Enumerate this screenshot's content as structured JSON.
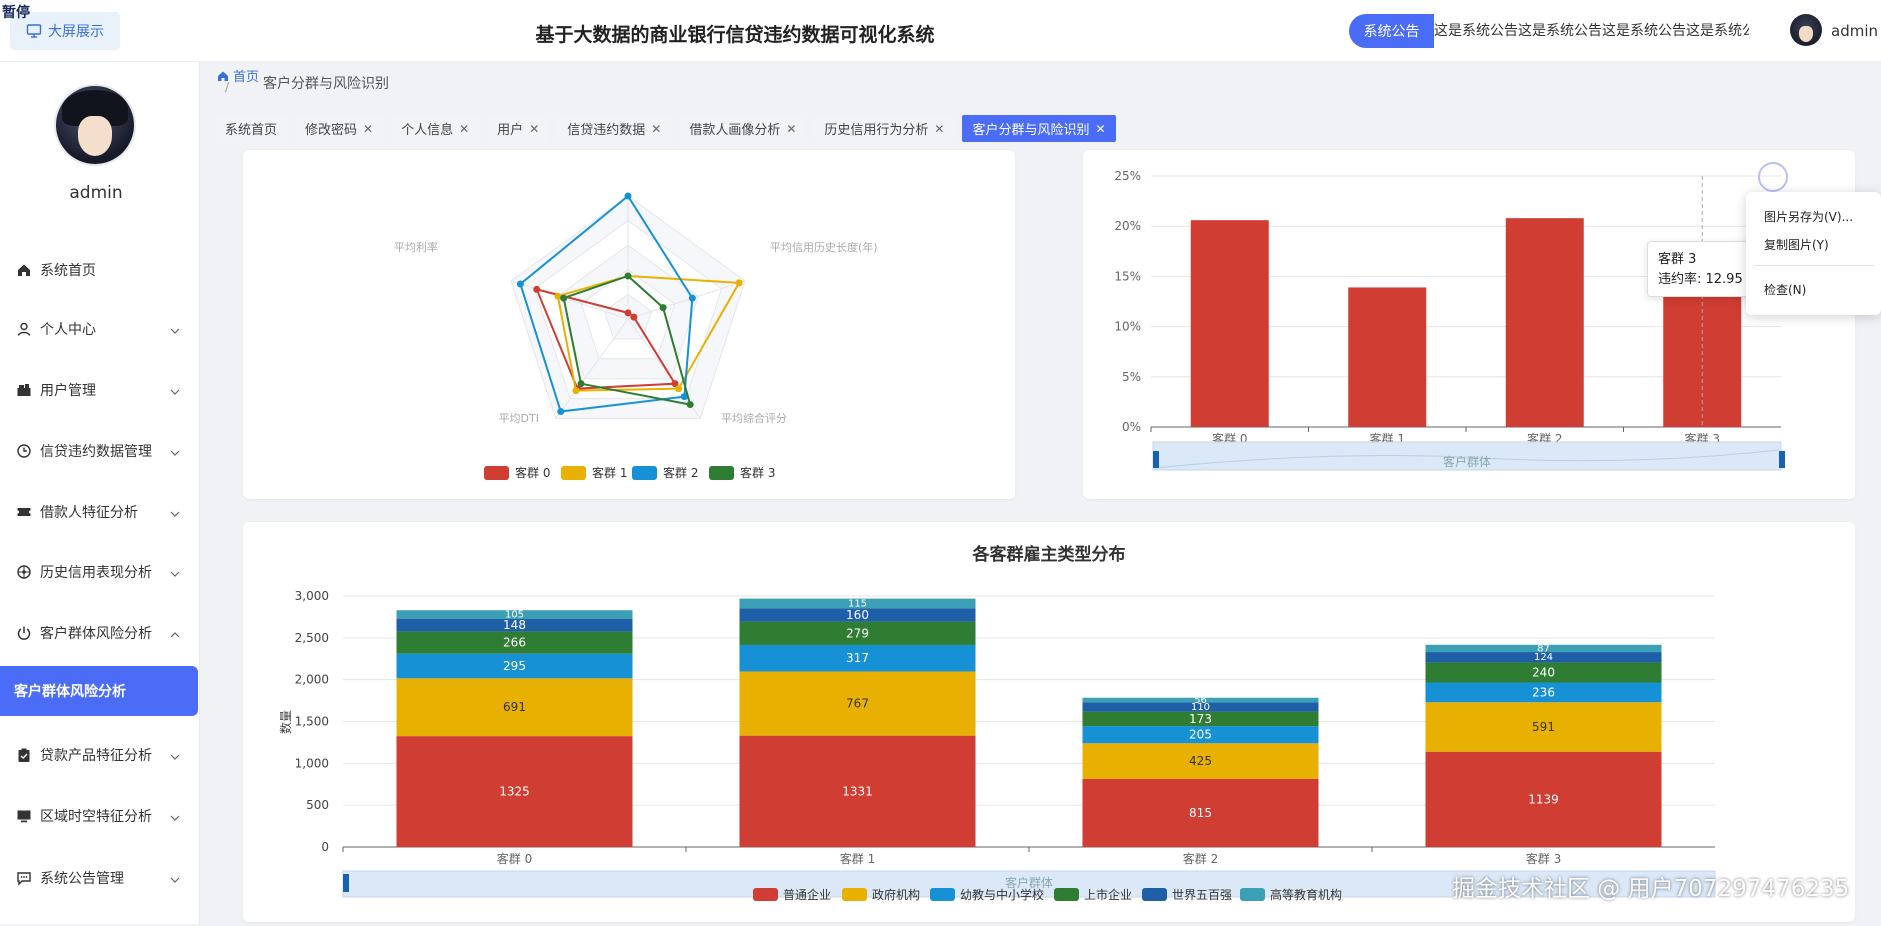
{
  "overlay": {
    "pause_label": "暂停"
  },
  "header": {
    "big_screen_label": "大屏展示",
    "title": "基于大数据的商业银行信贷违约数据可视化系统",
    "notice_badge": "系统公告",
    "notice_text": "这是系统公告这是系统公告这是系统公告这是系统公告",
    "username": "admin"
  },
  "sidebar": {
    "username": "admin",
    "items": [
      {
        "label": "系统首页",
        "icon": "home-icon"
      },
      {
        "label": "个人中心",
        "icon": "user-icon"
      },
      {
        "label": "用户管理",
        "icon": "users-icon"
      },
      {
        "label": "信贷违约数据管理",
        "icon": "clock-icon"
      },
      {
        "label": "借款人特征分析",
        "icon": "ticket-icon"
      },
      {
        "label": "历史信用表现分析",
        "icon": "compass-icon"
      },
      {
        "label": "客户群体风险分析",
        "icon": "power-icon"
      },
      {
        "label": "贷款产品特征分析",
        "icon": "clipboard-icon"
      },
      {
        "label": "区域时空特征分析",
        "icon": "monitor-icon"
      },
      {
        "label": "系统公告管理",
        "icon": "message-icon"
      }
    ],
    "active_sub": "客户群体风险分析"
  },
  "breadcrumb": {
    "home": "首页",
    "separator": "/",
    "current": "客户分群与风险识别"
  },
  "tabs": [
    {
      "label": "系统首页",
      "closable": false,
      "active": false
    },
    {
      "label": "修改密码",
      "closable": true,
      "active": false
    },
    {
      "label": "个人信息",
      "closable": true,
      "active": false
    },
    {
      "label": "用户",
      "closable": true,
      "active": false
    },
    {
      "label": "信贷违约数据",
      "closable": true,
      "active": false
    },
    {
      "label": "借款人画像分析",
      "closable": true,
      "active": false
    },
    {
      "label": "历史信用行为分析",
      "closable": true,
      "active": false
    },
    {
      "label": "客户分群与风险识别",
      "closable": true,
      "active": true
    }
  ],
  "tooltip": {
    "title": "客群 3",
    "line": "违约率: 12.95"
  },
  "context_menu": {
    "items": [
      "图片另存为(V)...",
      "复制图片(Y)",
      "检查(N)"
    ]
  },
  "watermark": "掘金技术社区 @ 用户707297476235",
  "colors": {
    "series0": "#cf3d33",
    "series1": "#e8b000",
    "series2": "#1791d6",
    "series3": "#2e7d32",
    "series4": "#1f5fa8",
    "series5": "#3ba0b5",
    "accent": "#4a6cf7"
  },
  "chart_data": [
    {
      "type": "radar",
      "indicators": [
        "平均信用历史长度(年)",
        "平均综合评分",
        "平均DTI",
        "平均利率"
      ],
      "legend": [
        "客群 0",
        "客群 1",
        "客群 2",
        "客群 3"
      ],
      "series": [
        {
          "name": "客群 0",
          "values": [
            0.05,
            0.05,
            0.65,
            0.7,
            0.78
          ]
        },
        {
          "name": "客群 1",
          "values": [
            0.35,
            0.95,
            0.7,
            0.72,
            0.6
          ]
        },
        {
          "name": "客群 2",
          "values": [
            1.0,
            0.55,
            0.78,
            0.93,
            0.92
          ]
        },
        {
          "name": "客群 3",
          "values": [
            0.35,
            0.3,
            0.86,
            0.65,
            0.55
          ]
        }
      ]
    },
    {
      "type": "bar",
      "categories": [
        "客群 0",
        "客群 1",
        "客群 2",
        "客群 3"
      ],
      "values": [
        20.6,
        13.9,
        20.8,
        12.95
      ],
      "yticks": [
        "0%",
        "5%",
        "10%",
        "15%",
        "20%",
        "25%"
      ],
      "ylim": [
        0,
        25
      ],
      "xlabel": "客户群体",
      "grid": true
    },
    {
      "type": "bar",
      "stacked": true,
      "title": "各客群雇主类型分布",
      "categories": [
        "客群 0",
        "客群 1",
        "客群 2",
        "客群 3"
      ],
      "ylabel": "数量",
      "xlabel": "客户群体",
      "ylim": [
        0,
        3000
      ],
      "yticks": [
        "0",
        "500",
        "1,000",
        "1,500",
        "2,000",
        "2,500",
        "3,000"
      ],
      "series": [
        {
          "name": "普通企业",
          "values": [
            1325,
            1331,
            815,
            1139
          ]
        },
        {
          "name": "政府机构",
          "values": [
            691,
            767,
            425,
            591
          ]
        },
        {
          "name": "幼教与中小学校",
          "values": [
            295,
            317,
            205,
            236
          ]
        },
        {
          "name": "上市企业",
          "values": [
            266,
            279,
            173,
            240
          ]
        },
        {
          "name": "世界五百强",
          "values": [
            148,
            160,
            110,
            124
          ]
        },
        {
          "name": "高等教育机构",
          "values": [
            105,
            115,
            56,
            87
          ]
        }
      ]
    }
  ]
}
